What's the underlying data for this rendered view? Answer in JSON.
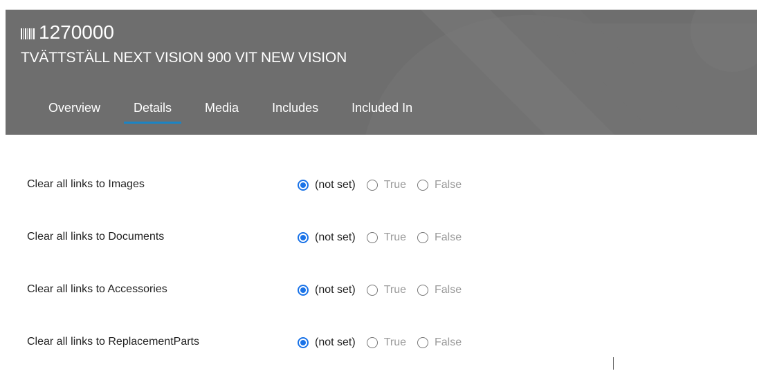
{
  "header": {
    "product_number": "1270000",
    "product_name": "TVÄTTSTÄLL NEXT VISION 900 VIT NEW VISION",
    "icon": "barcode-icon",
    "background_color": "#6e6e6e",
    "accent_color": "#1b84c4"
  },
  "tabs": [
    {
      "label": "Overview",
      "active": false
    },
    {
      "label": "Details",
      "active": true
    },
    {
      "label": "Media",
      "active": false
    },
    {
      "label": "Includes",
      "active": false
    },
    {
      "label": "Included In",
      "active": false
    }
  ],
  "fields": [
    {
      "label": "Clear all links to Images",
      "options": [
        "(not set)",
        "True",
        "False"
      ],
      "selected": "(not set)"
    },
    {
      "label": "Clear all links to Documents",
      "options": [
        "(not set)",
        "True",
        "False"
      ],
      "selected": "(not set)"
    },
    {
      "label": "Clear all links to Accessories",
      "options": [
        "(not set)",
        "True",
        "False"
      ],
      "selected": "(not set)"
    },
    {
      "label": "Clear all links to ReplacementParts",
      "options": [
        "(not set)",
        "True",
        "False"
      ],
      "selected": "(not set)"
    }
  ]
}
